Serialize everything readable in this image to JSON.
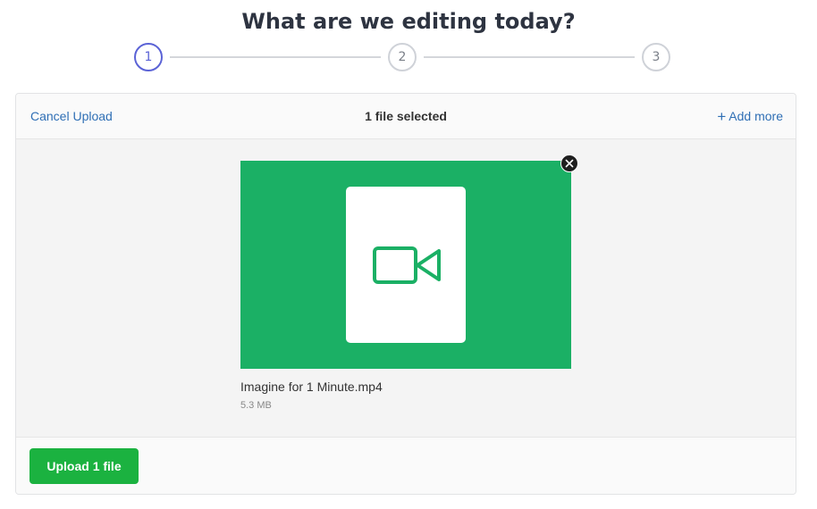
{
  "page_title": "What are we editing today?",
  "stepper": {
    "steps": [
      "1",
      "2",
      "3"
    ],
    "active_step": 1
  },
  "topbar": {
    "cancel_label": "Cancel Upload",
    "selected_text": "1 file selected",
    "add_more_icon": "plus-icon",
    "add_more_label": "Add more"
  },
  "file": {
    "name": "Imagine for 1 Minute.mp4",
    "size": "5.3 MB",
    "type_icon": "video-camera-icon",
    "remove_icon": "close-icon"
  },
  "footer": {
    "upload_label": "Upload 1 file"
  },
  "colors": {
    "accent_step": "#5b63d6",
    "link": "#2f6fb5",
    "preview_bg": "#1bb065",
    "upload_button": "#1bb240",
    "title": "#2e3441"
  }
}
